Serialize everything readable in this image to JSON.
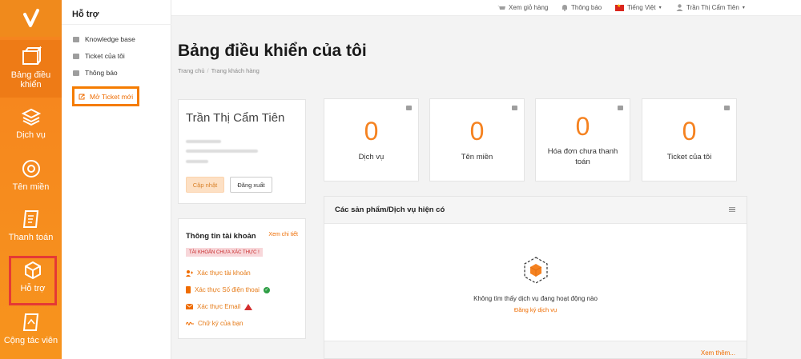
{
  "rail": {
    "items": [
      {
        "label_line1": "Bảng điều",
        "label_line2": "khiển",
        "icon": "dashboard-box-icon"
      },
      {
        "label": "Dịch vụ",
        "icon": "service-stack-icon"
      },
      {
        "label": "Tên miền",
        "icon": "domain-globe-icon"
      },
      {
        "label": "Thanh toán",
        "icon": "billing-doc-icon"
      },
      {
        "label": "Hỗ trợ",
        "icon": "support-box-icon"
      },
      {
        "label": "Cộng tác viên",
        "icon": "affiliate-doc-icon"
      }
    ]
  },
  "submenu": {
    "title": "Hỗ trợ",
    "items": [
      {
        "label": "Knowledge base",
        "icon": "knowledge-base-icon"
      },
      {
        "label": "Ticket của tôi",
        "icon": "ticket-icon"
      },
      {
        "label": "Thông báo",
        "icon": "announcement-flag-icon"
      }
    ],
    "new_ticket": "Mở Ticket mới"
  },
  "topbar": {
    "cart": "Xem giỏ hàng",
    "notifications": "Thông báo",
    "language": "Tiếng Việt",
    "user": "Trần Thị Cẩm Tiên"
  },
  "main": {
    "title": "Bảng điều khiển của tôi",
    "breadcrumb": [
      "Trang chủ",
      "Trang khách hàng"
    ],
    "profile": {
      "name": "Trần Thị Cẩm Tiên",
      "update_button": "Cập nhật",
      "logout_button": "Đăng xuất"
    },
    "account": {
      "title": "Thông tin tài khoản",
      "more": "Xem chi tiết",
      "badge": "TÀI KHOẢN CHƯA XÁC THỰC !",
      "links": [
        "Xác thực tài khoản",
        "Xác thực Số điện thoại",
        "Xác thực Email",
        "Chữ ký của bạn"
      ]
    },
    "stats": [
      {
        "value": "0",
        "label": "Dịch vụ"
      },
      {
        "value": "0",
        "label": "Tên miền"
      },
      {
        "value": "0",
        "label": "Hóa đơn chưa thanh toán"
      },
      {
        "value": "0",
        "label": "Ticket của tôi"
      }
    ],
    "products": {
      "title": "Các sản phẩm/Dịch vụ hiện có",
      "empty": "Không tìm thấy dịch vụ đang hoạt động nào",
      "register": "Đăng ký dịch vụ",
      "see_more": "Xem thêm..."
    }
  },
  "colors": {
    "accent": "#f58220",
    "rail": "#f7941d",
    "highlight_box": "#e53935"
  }
}
